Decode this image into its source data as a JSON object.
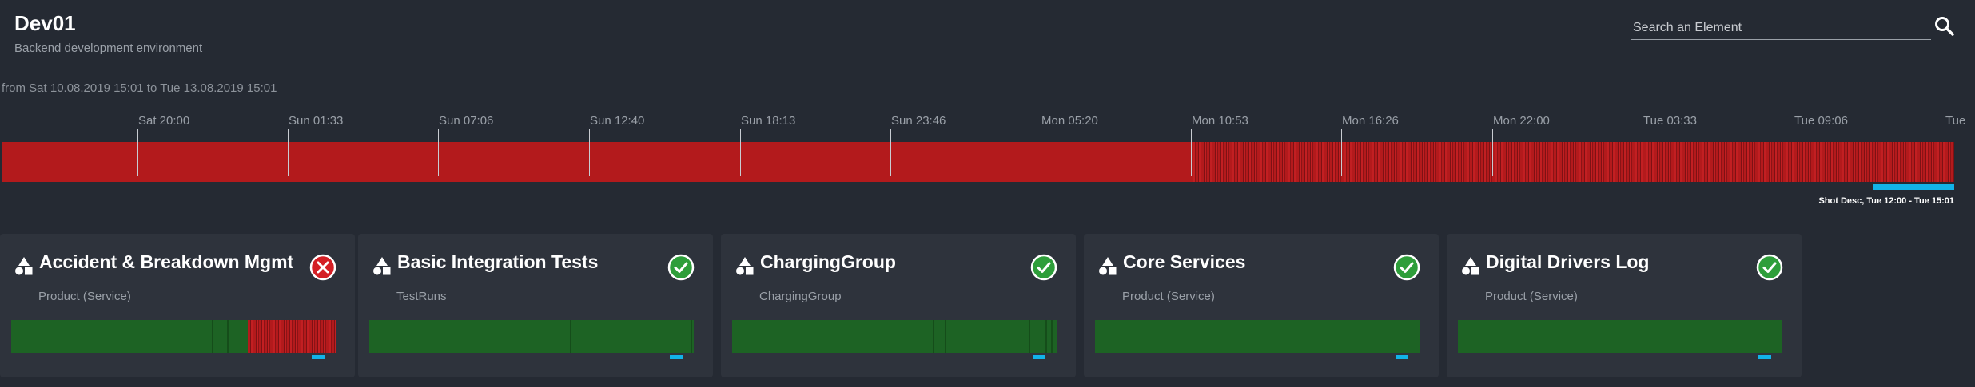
{
  "header": {
    "title": "Dev01",
    "subtitle": "Backend development environment"
  },
  "search": {
    "placeholder": "Search an Element",
    "icon": "search-icon"
  },
  "timeline": {
    "range_text": "from Sat 10.08.2019 15:01 to Tue 13.08.2019 15:01",
    "ticks": [
      "Sat 20:00",
      "Sun 01:33",
      "Sun 07:06",
      "Sun 12:40",
      "Sun 18:13",
      "Sun 23:46",
      "Mon 05:20",
      "Mon 10:53",
      "Mon 16:26",
      "Mon 22:00",
      "Tue 03:33",
      "Tue 09:06",
      "Tue"
    ],
    "bar_color": "#b31a1c",
    "selection_label": "Shot Desc, Tue 12:00 - Tue 15:01",
    "selection_color": "#12b3e8"
  },
  "cards": [
    {
      "title": "Accident & Breakdown Mgmt",
      "subtitle": "Product (Service)",
      "status": "error",
      "status_icon": "error-x-icon"
    },
    {
      "title": "Basic Integration Tests",
      "subtitle": "TestRuns",
      "status": "ok",
      "status_icon": "check-circle-icon"
    },
    {
      "title": "ChargingGroup",
      "subtitle": "ChargingGroup",
      "status": "ok",
      "status_icon": "check-circle-icon"
    },
    {
      "title": "Core Services",
      "subtitle": "Product (Service)",
      "status": "ok",
      "status_icon": "check-circle-icon"
    },
    {
      "title": "Digital Drivers Log",
      "subtitle": "Product (Service)",
      "status": "ok",
      "status_icon": "check-circle-icon"
    }
  ],
  "colors": {
    "background": "#252a33",
    "card": "#2e333c",
    "ok_bar": "#1d6324",
    "error_bar": "#b31a1c",
    "accent": "#12b3e8",
    "status_ok": "#2e9e3a",
    "status_error": "#d42026"
  }
}
